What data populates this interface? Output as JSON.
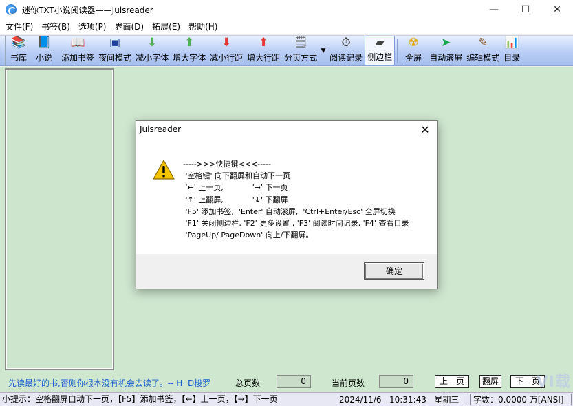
{
  "window": {
    "title": "迷你TXT小说阅读器——Juisreader"
  },
  "menu": [
    "文件(F)",
    "书签(B)",
    "选项(P)",
    "界面(D)",
    "拓展(E)",
    "帮助(H)"
  ],
  "toolbar": {
    "buttons": [
      {
        "label": "书库",
        "icon": "bookshelf-icon",
        "glyph": "📚",
        "color": "#d6306e"
      },
      {
        "label": "小说",
        "icon": "book-icon",
        "glyph": "📘",
        "color": "#1e5cc0"
      },
      {
        "label": "添加书签",
        "icon": "bookmark-icon",
        "glyph": "📖",
        "color": "#333"
      },
      {
        "label": "夜间模式",
        "icon": "night-mode-icon",
        "glyph": "▣",
        "color": "#1e3f9c"
      },
      {
        "label": "减小字体",
        "icon": "arrow-down-green-icon",
        "glyph": "⬇",
        "color": "#4caf50"
      },
      {
        "label": "增大字体",
        "icon": "arrow-up-green-icon",
        "glyph": "⬆",
        "color": "#4caf50"
      },
      {
        "label": "减小行距",
        "icon": "arrow-down-red-icon",
        "glyph": "⬇",
        "color": "#e53935"
      },
      {
        "label": "增大行距",
        "icon": "arrow-up-red-icon",
        "glyph": "⬆",
        "color": "#e53935"
      },
      {
        "label": "分页方式",
        "icon": "paging-icon",
        "glyph": "🗒",
        "color": "#555"
      },
      {
        "label": "阅读记录",
        "icon": "clock-icon",
        "glyph": "⏱",
        "color": "#333"
      },
      {
        "label": "侧边栏",
        "icon": "sidebar-icon",
        "glyph": "▰",
        "color": "#444"
      },
      {
        "label": "全屏",
        "icon": "fullscreen-icon",
        "glyph": "☢",
        "color": "#e6a100"
      },
      {
        "label": "自动滚屏",
        "icon": "cursor-icon",
        "glyph": "➤",
        "color": "#16a34a"
      },
      {
        "label": "编辑模式",
        "icon": "pen-icon",
        "glyph": "✎",
        "color": "#8a5a2b"
      },
      {
        "label": "目录",
        "icon": "chart-icon",
        "glyph": "📊",
        "color": "#2e7d32"
      }
    ]
  },
  "bottom": {
    "quote": "先读最好的书,否则你根本没有机会去读了。-- H· D梭罗",
    "total_pages_label": "总页数",
    "total_pages_value": "0",
    "current_page_label": "当前页数",
    "current_page_value": "0",
    "prev_label": "上一页",
    "flip_label": "翻屏",
    "next_label": "下一页"
  },
  "status": {
    "tip": "小提示：空格翻屏自动下一页，【F5】添加书签，【←】上一页，【→】下一页",
    "date": "2024/11/6",
    "time": "10:31:43",
    "weekday": "星期三",
    "wordcount": "字数：0.0000 万[ANSI]"
  },
  "dialog": {
    "title": "Juisreader",
    "message": "----->>>快捷键<<<-----\n '空格键' 向下翻屏和自动下一页\n '←' 上一页,            '→' 下一页\n '↑' 上翻屏,            '↓' 下翻屏\n 'F5' 添加书签,  'Enter' 自动滚屏,  'Ctrl+Enter/Esc' 全屏切换\n 'F1' 关闭侧边栏, 'F2' 更多设置 , 'F3' 阅读时间记录, 'F4' 查看目录\n 'PageUp/ PageDown' 向上/下翻屏。",
    "ok_label": "确定"
  },
  "watermark": "VI载"
}
